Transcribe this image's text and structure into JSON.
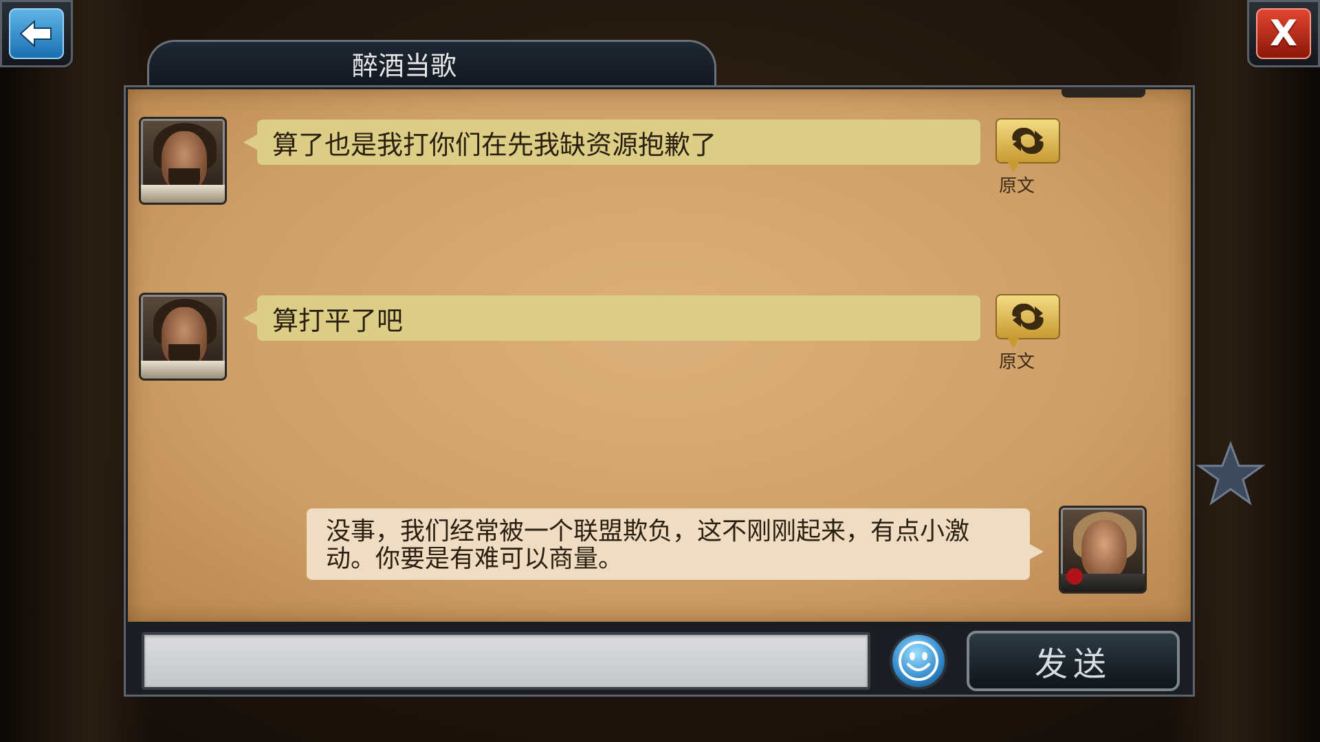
{
  "window": {
    "title": "醉酒当歌"
  },
  "nav": {
    "back_icon": "back-arrow-icon",
    "close_icon": "close-x-icon",
    "close_glyph": "X"
  },
  "messages": [
    {
      "side": "left",
      "text": "算了也是我打你们在先我缺资源抱歉了",
      "translate_label": "原文"
    },
    {
      "side": "left",
      "text": "算打平了吧",
      "translate_label": "原文"
    },
    {
      "side": "right",
      "text": "没事，我们经常被一个联盟欺负，这不刚刚起来，有点小激动。你要是有难可以商量。"
    }
  ],
  "composer": {
    "input_value": "",
    "input_placeholder": "",
    "emoji_icon": "smiley-icon",
    "send_label": "发送"
  },
  "side_panel": {
    "favorite_icon": "star-icon"
  },
  "colors": {
    "parchment": "#d4a670",
    "bubble_incoming": "#dccd87",
    "bubble_outgoing": "#efdcc2",
    "back_button": "#1b6fb0",
    "close_button": "#c0301c"
  }
}
